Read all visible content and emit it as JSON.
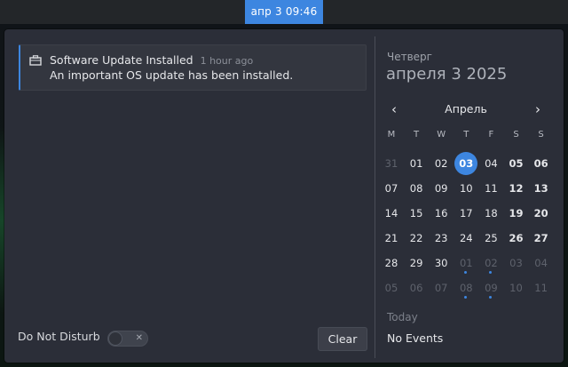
{
  "topbar": {
    "clock": "апр 3  09:46"
  },
  "notification": {
    "title": "Software Update Installed",
    "time": "1 hour ago",
    "body": "An important OS update has been installed."
  },
  "dnd": {
    "label": "Do Not Disturb",
    "state": "off",
    "toggle_symbol": "✕"
  },
  "clear_label": "Clear",
  "calendar": {
    "weekday": "Четверг",
    "date": "апреля 3 2025",
    "month": "Апрель",
    "prev_icon": "‹",
    "next_icon": "›",
    "headers": [
      "M",
      "T",
      "W",
      "T",
      "F",
      "S",
      "S"
    ],
    "weeks": [
      [
        {
          "d": "31",
          "m": true
        },
        {
          "d": "01"
        },
        {
          "d": "02"
        },
        {
          "d": "03",
          "today": true
        },
        {
          "d": "04"
        },
        {
          "d": "05",
          "b": true
        },
        {
          "d": "06",
          "b": true
        }
      ],
      [
        {
          "d": "07"
        },
        {
          "d": "08"
        },
        {
          "d": "09"
        },
        {
          "d": "10"
        },
        {
          "d": "11"
        },
        {
          "d": "12",
          "b": true
        },
        {
          "d": "13",
          "b": true
        }
      ],
      [
        {
          "d": "14"
        },
        {
          "d": "15"
        },
        {
          "d": "16"
        },
        {
          "d": "17"
        },
        {
          "d": "18"
        },
        {
          "d": "19",
          "b": true
        },
        {
          "d": "20",
          "b": true
        }
      ],
      [
        {
          "d": "21"
        },
        {
          "d": "22"
        },
        {
          "d": "23"
        },
        {
          "d": "24"
        },
        {
          "d": "25"
        },
        {
          "d": "26",
          "b": true
        },
        {
          "d": "27",
          "b": true
        }
      ],
      [
        {
          "d": "28"
        },
        {
          "d": "29"
        },
        {
          "d": "30"
        },
        {
          "d": "01",
          "m": true,
          "dot": true
        },
        {
          "d": "02",
          "m": true,
          "dot": true
        },
        {
          "d": "03",
          "m": true
        },
        {
          "d": "04",
          "m": true
        }
      ],
      [
        {
          "d": "05",
          "m": true
        },
        {
          "d": "06",
          "m": true
        },
        {
          "d": "07",
          "m": true
        },
        {
          "d": "08",
          "m": true,
          "dot": true
        },
        {
          "d": "09",
          "m": true,
          "dot": true
        },
        {
          "d": "10",
          "m": true
        },
        {
          "d": "11",
          "m": true
        }
      ]
    ],
    "today_label": "Today",
    "no_events": "No Events"
  },
  "colors": {
    "accent": "#3d86e0",
    "panel": "#2b2e38",
    "card": "#33363f"
  }
}
